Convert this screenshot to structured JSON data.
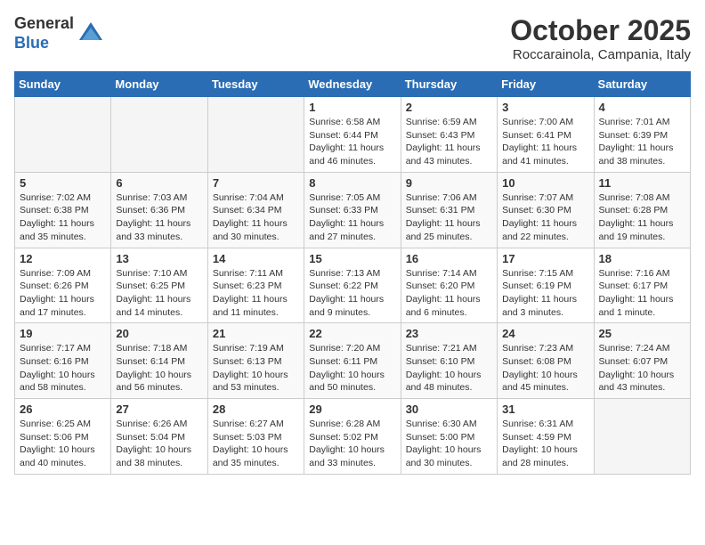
{
  "header": {
    "logo_general": "General",
    "logo_blue": "Blue",
    "month_title": "October 2025",
    "location": "Roccarainola, Campania, Italy"
  },
  "days_of_week": [
    "Sunday",
    "Monday",
    "Tuesday",
    "Wednesday",
    "Thursday",
    "Friday",
    "Saturday"
  ],
  "weeks": [
    [
      {
        "day": "",
        "info": ""
      },
      {
        "day": "",
        "info": ""
      },
      {
        "day": "",
        "info": ""
      },
      {
        "day": "1",
        "info": "Sunrise: 6:58 AM\nSunset: 6:44 PM\nDaylight: 11 hours and 46 minutes."
      },
      {
        "day": "2",
        "info": "Sunrise: 6:59 AM\nSunset: 6:43 PM\nDaylight: 11 hours and 43 minutes."
      },
      {
        "day": "3",
        "info": "Sunrise: 7:00 AM\nSunset: 6:41 PM\nDaylight: 11 hours and 41 minutes."
      },
      {
        "day": "4",
        "info": "Sunrise: 7:01 AM\nSunset: 6:39 PM\nDaylight: 11 hours and 38 minutes."
      }
    ],
    [
      {
        "day": "5",
        "info": "Sunrise: 7:02 AM\nSunset: 6:38 PM\nDaylight: 11 hours and 35 minutes."
      },
      {
        "day": "6",
        "info": "Sunrise: 7:03 AM\nSunset: 6:36 PM\nDaylight: 11 hours and 33 minutes."
      },
      {
        "day": "7",
        "info": "Sunrise: 7:04 AM\nSunset: 6:34 PM\nDaylight: 11 hours and 30 minutes."
      },
      {
        "day": "8",
        "info": "Sunrise: 7:05 AM\nSunset: 6:33 PM\nDaylight: 11 hours and 27 minutes."
      },
      {
        "day": "9",
        "info": "Sunrise: 7:06 AM\nSunset: 6:31 PM\nDaylight: 11 hours and 25 minutes."
      },
      {
        "day": "10",
        "info": "Sunrise: 7:07 AM\nSunset: 6:30 PM\nDaylight: 11 hours and 22 minutes."
      },
      {
        "day": "11",
        "info": "Sunrise: 7:08 AM\nSunset: 6:28 PM\nDaylight: 11 hours and 19 minutes."
      }
    ],
    [
      {
        "day": "12",
        "info": "Sunrise: 7:09 AM\nSunset: 6:26 PM\nDaylight: 11 hours and 17 minutes."
      },
      {
        "day": "13",
        "info": "Sunrise: 7:10 AM\nSunset: 6:25 PM\nDaylight: 11 hours and 14 minutes."
      },
      {
        "day": "14",
        "info": "Sunrise: 7:11 AM\nSunset: 6:23 PM\nDaylight: 11 hours and 11 minutes."
      },
      {
        "day": "15",
        "info": "Sunrise: 7:13 AM\nSunset: 6:22 PM\nDaylight: 11 hours and 9 minutes."
      },
      {
        "day": "16",
        "info": "Sunrise: 7:14 AM\nSunset: 6:20 PM\nDaylight: 11 hours and 6 minutes."
      },
      {
        "day": "17",
        "info": "Sunrise: 7:15 AM\nSunset: 6:19 PM\nDaylight: 11 hours and 3 minutes."
      },
      {
        "day": "18",
        "info": "Sunrise: 7:16 AM\nSunset: 6:17 PM\nDaylight: 11 hours and 1 minute."
      }
    ],
    [
      {
        "day": "19",
        "info": "Sunrise: 7:17 AM\nSunset: 6:16 PM\nDaylight: 10 hours and 58 minutes."
      },
      {
        "day": "20",
        "info": "Sunrise: 7:18 AM\nSunset: 6:14 PM\nDaylight: 10 hours and 56 minutes."
      },
      {
        "day": "21",
        "info": "Sunrise: 7:19 AM\nSunset: 6:13 PM\nDaylight: 10 hours and 53 minutes."
      },
      {
        "day": "22",
        "info": "Sunrise: 7:20 AM\nSunset: 6:11 PM\nDaylight: 10 hours and 50 minutes."
      },
      {
        "day": "23",
        "info": "Sunrise: 7:21 AM\nSunset: 6:10 PM\nDaylight: 10 hours and 48 minutes."
      },
      {
        "day": "24",
        "info": "Sunrise: 7:23 AM\nSunset: 6:08 PM\nDaylight: 10 hours and 45 minutes."
      },
      {
        "day": "25",
        "info": "Sunrise: 7:24 AM\nSunset: 6:07 PM\nDaylight: 10 hours and 43 minutes."
      }
    ],
    [
      {
        "day": "26",
        "info": "Sunrise: 6:25 AM\nSunset: 5:06 PM\nDaylight: 10 hours and 40 minutes."
      },
      {
        "day": "27",
        "info": "Sunrise: 6:26 AM\nSunset: 5:04 PM\nDaylight: 10 hours and 38 minutes."
      },
      {
        "day": "28",
        "info": "Sunrise: 6:27 AM\nSunset: 5:03 PM\nDaylight: 10 hours and 35 minutes."
      },
      {
        "day": "29",
        "info": "Sunrise: 6:28 AM\nSunset: 5:02 PM\nDaylight: 10 hours and 33 minutes."
      },
      {
        "day": "30",
        "info": "Sunrise: 6:30 AM\nSunset: 5:00 PM\nDaylight: 10 hours and 30 minutes."
      },
      {
        "day": "31",
        "info": "Sunrise: 6:31 AM\nSunset: 4:59 PM\nDaylight: 10 hours and 28 minutes."
      },
      {
        "day": "",
        "info": ""
      }
    ]
  ]
}
